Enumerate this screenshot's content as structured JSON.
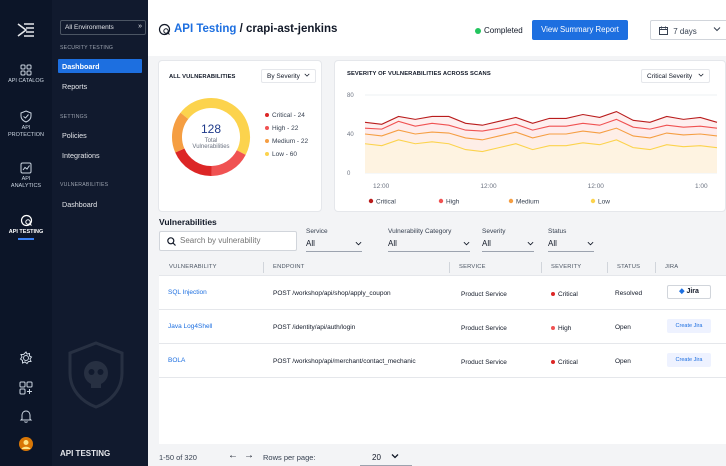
{
  "rail": {
    "items": [
      {
        "label": "API CATALOG",
        "icon": "grid-icon"
      },
      {
        "label": "API PROTECTION",
        "icon": "shield-check-icon"
      },
      {
        "label": "API ANALYTICS",
        "icon": "analytics-icon"
      },
      {
        "label": "API TESTING",
        "icon": "testing-icon",
        "active": true
      }
    ],
    "bottom_icons": [
      "settings-icon",
      "apps-icon",
      "bell-icon",
      "avatar"
    ]
  },
  "sidebar": {
    "environment": "All Environments",
    "collapse_glyph": "»",
    "sections": [
      {
        "title": "SECURITY TESTING",
        "items": [
          "Dashboard",
          "Reports"
        ]
      },
      {
        "title": "SETTINGS",
        "items": [
          "Policies",
          "Integrations"
        ]
      },
      {
        "title": "VULNERABILITIES",
        "items": [
          "Dashboard"
        ]
      }
    ],
    "footer": "API TESTING",
    "footer_toggle": "‹"
  },
  "header": {
    "crumb": "API Testing",
    "separator": " / ",
    "title": "crapi-ast-jenkins",
    "status": "Completed",
    "status_color": "#22c55e",
    "report_button": "View Summary Report",
    "date_range": "7 days"
  },
  "all_vulns": {
    "title": "ALL VULNERABILITIES",
    "group_by": "By Severity",
    "total": "128",
    "total_label_1": "Total",
    "total_label_2": "Vulnerabilities",
    "legend": [
      {
        "label": "Critical - 24",
        "color": "#dc2626"
      },
      {
        "label": "High - 22",
        "color": "#f05252"
      },
      {
        "label": "Medium - 22",
        "color": "#f59e42"
      },
      {
        "label": "Low - 60",
        "color": "#fcd34d"
      }
    ]
  },
  "chart_data": {
    "type": "line",
    "title": "SEVERITY OF VULNERABILITIES ACROSS SCANS",
    "filter": "Critical Severity",
    "x_labels": [
      "12:00",
      "12:00",
      "12:00",
      "1:00"
    ],
    "y_ticks": [
      "80",
      "40",
      "0"
    ],
    "ylim": [
      0,
      80
    ],
    "grid": true,
    "legend_position": "bottom",
    "series": [
      {
        "name": "Critical",
        "color": "#b91c1c",
        "values": [
          52,
          50,
          58,
          55,
          58,
          58,
          51,
          49,
          53,
          57,
          51,
          56,
          56,
          60,
          57,
          63,
          54,
          52,
          58,
          55,
          57,
          52
        ]
      },
      {
        "name": "High",
        "color": "#f05252",
        "values": [
          46,
          45,
          53,
          48,
          51,
          49,
          44,
          43,
          46,
          50,
          44,
          48,
          48,
          51,
          49,
          55,
          47,
          45,
          49,
          47,
          48,
          46
        ]
      },
      {
        "name": "Medium",
        "color": "#f59e42",
        "values": [
          40,
          38,
          44,
          40,
          42,
          41,
          36,
          34,
          38,
          42,
          36,
          40,
          40,
          43,
          41,
          46,
          38,
          36,
          41,
          39,
          40,
          38
        ]
      },
      {
        "name": "Low",
        "color": "#fcd34d",
        "values": [
          30,
          28,
          34,
          30,
          32,
          30,
          24,
          22,
          26,
          30,
          24,
          28,
          28,
          31,
          29,
          34,
          26,
          24,
          29,
          27,
          28,
          26
        ]
      }
    ]
  },
  "vulnerabilities": {
    "title": "Vulnerabilities",
    "search_placeholder": "Search by vulnerability",
    "filters": [
      {
        "label": "Service",
        "value": "All"
      },
      {
        "label": "Vulnerability Category",
        "value": "All"
      },
      {
        "label": "Severity",
        "value": "All"
      },
      {
        "label": "Status",
        "value": "All"
      }
    ],
    "columns": [
      "VULNERABILITY",
      "ENDPOINT",
      "SERVICE",
      "SEVERITY",
      "STATUS",
      "JIRA"
    ],
    "rows": [
      {
        "name": "SQL Injection",
        "endpoint": "POST /workshop/api/shop/apply_coupon",
        "service": "Product Service",
        "severity": "Critical",
        "severity_color": "#dc2626",
        "status": "Resolved",
        "jira": "Jira"
      },
      {
        "name": "Java Log4Shell",
        "endpoint": "POST /identity/api/auth/login",
        "service": "Product Service",
        "severity": "High",
        "severity_color": "#f05252",
        "status": "Open",
        "jira": "Create Jira"
      },
      {
        "name": "BOLA",
        "endpoint": "POST /workshop/api/merchant/contact_mechanic",
        "service": "Product Service",
        "severity": "Critical",
        "severity_color": "#dc2626",
        "status": "Open",
        "jira": "Create Jira"
      }
    ],
    "pagination": "1-50 of 320",
    "rows_per_page_label": "Rows per page:",
    "rows_per_page": "20"
  }
}
